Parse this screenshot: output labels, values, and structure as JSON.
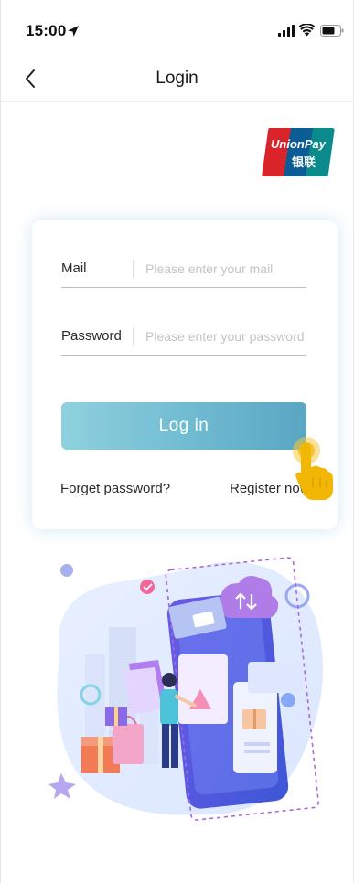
{
  "status_bar": {
    "time": "15:00"
  },
  "nav": {
    "title": "Login"
  },
  "form": {
    "mail_label": "Mail",
    "mail_placeholder": "Please enter your mail",
    "password_label": "Password",
    "password_placeholder": "Please enter your password",
    "login_label": "Log in",
    "forget_label": "Forget password?",
    "register_label": "Register now"
  },
  "colors": {
    "button_gradient_start": "#8fd1de",
    "button_gradient_end": "#5aa6c3",
    "hand_pointer": "#f2b705",
    "unionpay_red": "#d9252a",
    "unionpay_blue": "#0c5c95",
    "unionpay_teal": "#0a8a8a"
  }
}
